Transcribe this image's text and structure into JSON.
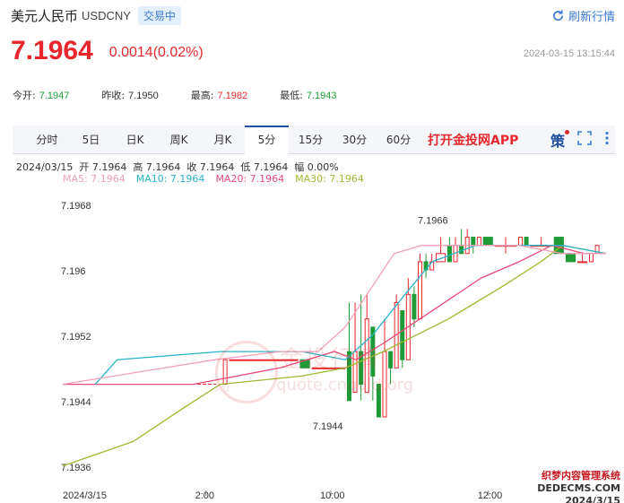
{
  "header": {
    "name": "美元人民币",
    "code": "USDCNY",
    "status": "交易中",
    "refresh_label": "刷新行情"
  },
  "quote": {
    "price": "7.1964",
    "change": "0.0014(0.02%)",
    "timestamp": "2024-03-15 13:15:44"
  },
  "stats": [
    {
      "label": "今开:",
      "value": "7.1947",
      "color": "green"
    },
    {
      "label": "昨收:",
      "value": "7.1950",
      "color": "neutral"
    },
    {
      "label": "最高:",
      "value": "7.1982",
      "color": "red"
    },
    {
      "label": "最低:",
      "value": "7.1943",
      "color": "green"
    }
  ],
  "tabs": [
    "分时",
    "5日",
    "日K",
    "周K",
    "月K",
    "5分",
    "15分",
    "30分",
    "60分"
  ],
  "active_tab": "5分",
  "promo": "打开金投网APP",
  "toolbar": {
    "ce_label": "策"
  },
  "info_line": "2024/03/15  开 7.1964  高 7.1964  收 7.1964  低 7.1964  幅 0.00%",
  "ma_labels": [
    {
      "text": "MA5: 7.1964",
      "color": "#f0a0b8"
    },
    {
      "text": "MA10: 7.1964",
      "color": "#2ab3c9"
    },
    {
      "text": "MA20: 7.1964",
      "color": "#e84a7a"
    },
    {
      "text": "MA30: 7.1964",
      "color": "#9cba2e"
    }
  ],
  "watermark": {
    "title": "金投行情",
    "site": "quote.cngold.org",
    "mark": "Au"
  },
  "corner": {
    "line1": "织梦内容管理系统",
    "line2": "DEDECMS.COM",
    "line3": "2024/3/15"
  },
  "chart_data": {
    "type": "candlestick",
    "y_ticks": [
      "7.1968",
      "7.196",
      "7.1952",
      "7.1944",
      "7.1936"
    ],
    "x_ticks": [
      "2024/3/15",
      "2:00",
      "10:00",
      "12:00"
    ],
    "ylim": [
      7.1934,
      7.197
    ],
    "high_annotation": "7.1966",
    "low_annotation": "7.1944",
    "colors": {
      "up": "#e8262c",
      "down": "#1f9a37",
      "ma5": "#f0a0b8",
      "ma10": "#2ab3c9",
      "ma20": "#e84a7a",
      "ma30": "#9cba2e"
    },
    "candles": [
      {
        "o": 7.1947,
        "c": 7.1947,
        "h": 7.1947,
        "l": 7.1947,
        "n": 26
      },
      {
        "o": 7.1947,
        "c": 7.195,
        "h": 7.195,
        "l": 7.1947,
        "n": 1
      },
      {
        "o": 7.195,
        "c": 7.195,
        "h": 7.195,
        "l": 7.195,
        "n": 12
      },
      {
        "o": 7.195,
        "c": 7.1949,
        "h": 7.195,
        "l": 7.1949,
        "n": 2
      },
      {
        "o": 7.1949,
        "c": 7.1949,
        "h": 7.1949,
        "l": 7.1949,
        "n": 6
      },
      {
        "o": 7.1951,
        "c": 7.1945,
        "h": 7.1957,
        "l": 7.1945,
        "n": 1
      },
      {
        "o": 7.1946,
        "c": 7.1951,
        "h": 7.1957,
        "l": 7.1946,
        "n": 1
      },
      {
        "o": 7.1951,
        "c": 7.1947,
        "h": 7.1958,
        "l": 7.1945,
        "n": 1
      },
      {
        "o": 7.1946,
        "c": 7.1955,
        "h": 7.1958,
        "l": 7.1946,
        "n": 1
      },
      {
        "o": 7.1954,
        "c": 7.1948,
        "h": 7.1954,
        "l": 7.1945,
        "n": 1
      },
      {
        "o": 7.1947,
        "c": 7.1943,
        "h": 7.1947,
        "l": 7.1943,
        "n": 1
      },
      {
        "o": 7.1943,
        "c": 7.1951,
        "h": 7.1955,
        "l": 7.1943,
        "n": 1
      },
      {
        "o": 7.1951,
        "c": 7.1949,
        "h": 7.1951,
        "l": 7.1947,
        "n": 1
      },
      {
        "o": 7.1949,
        "c": 7.1957,
        "h": 7.1958,
        "l": 7.1949,
        "n": 1
      },
      {
        "o": 7.1956,
        "c": 7.195,
        "h": 7.1956,
        "l": 7.1949,
        "n": 1
      },
      {
        "o": 7.195,
        "c": 7.1958,
        "h": 7.196,
        "l": 7.195,
        "n": 1
      },
      {
        "o": 7.1958,
        "c": 7.1955,
        "h": 7.1959,
        "l": 7.1954,
        "n": 1
      },
      {
        "o": 7.1955,
        "c": 7.1962,
        "h": 7.1963,
        "l": 7.1955,
        "n": 1
      },
      {
        "o": 7.1962,
        "c": 7.1961,
        "h": 7.1963,
        "l": 7.196,
        "n": 1
      },
      {
        "o": 7.1961,
        "c": 7.1962,
        "h": 7.1963,
        "l": 7.1961,
        "n": 1
      },
      {
        "o": 7.1962,
        "c": 7.1963,
        "h": 7.1965,
        "l": 7.1962,
        "n": 2
      },
      {
        "o": 7.1964,
        "c": 7.1962,
        "h": 7.1965,
        "l": 7.1962,
        "n": 1
      },
      {
        "o": 7.1962,
        "c": 7.1964,
        "h": 7.1965,
        "l": 7.1962,
        "n": 1
      },
      {
        "o": 7.1964,
        "c": 7.1963,
        "h": 7.1966,
        "l": 7.1963,
        "n": 1
      },
      {
        "o": 7.1963,
        "c": 7.1965,
        "h": 7.1966,
        "l": 7.1963,
        "n": 1
      },
      {
        "o": 7.1965,
        "c": 7.1964,
        "h": 7.1965,
        "l": 7.1963,
        "n": 1
      },
      {
        "o": 7.1964,
        "c": 7.1965,
        "h": 7.1965,
        "l": 7.1964,
        "n": 1
      },
      {
        "o": 7.1965,
        "c": 7.1964,
        "h": 7.1965,
        "l": 7.1964,
        "n": 2
      },
      {
        "o": 7.1964,
        "c": 7.1964,
        "h": 7.1965,
        "l": 7.1963,
        "n": 4
      },
      {
        "o": 7.1964,
        "c": 7.1965,
        "h": 7.1965,
        "l": 7.1964,
        "n": 1
      },
      {
        "o": 7.1965,
        "c": 7.1964,
        "h": 7.1965,
        "l": 7.1964,
        "n": 1
      },
      {
        "o": 7.1964,
        "c": 7.1964,
        "h": 7.1965,
        "l": 7.1964,
        "n": 4
      },
      {
        "o": 7.1965,
        "c": 7.1963,
        "h": 7.1965,
        "l": 7.1963,
        "n": 2
      },
      {
        "o": 7.1963,
        "c": 7.1962,
        "h": 7.1963,
        "l": 7.1962,
        "n": 2
      },
      {
        "o": 7.1962,
        "c": 7.1962,
        "h": 7.1963,
        "l": 7.1962,
        "n": 2
      },
      {
        "o": 7.1962,
        "c": 7.1963,
        "h": 7.1963,
        "l": 7.1962,
        "n": 1
      },
      {
        "o": 7.1963,
        "c": 7.1964,
        "h": 7.1964,
        "l": 7.1963,
        "n": 1
      }
    ],
    "ma": {
      "ma5": [
        [
          7.1947,
          0
        ],
        [
          7.195,
          0.28
        ],
        [
          7.1951,
          0.4
        ],
        [
          7.1951,
          0.47
        ],
        [
          7.1954,
          0.52
        ],
        [
          7.1958,
          0.56
        ],
        [
          7.1963,
          0.61
        ],
        [
          7.1964,
          0.66
        ],
        [
          7.1964,
          0.75
        ],
        [
          7.1964,
          0.84
        ],
        [
          7.1963,
          0.92
        ],
        [
          7.1963,
          1.0
        ]
      ],
      "ma10": [
        [
          7.1947,
          0.06
        ],
        [
          7.195,
          0.1
        ],
        [
          7.1951,
          0.29
        ],
        [
          7.1951,
          0.44
        ],
        [
          7.195,
          0.52
        ],
        [
          7.1953,
          0.57
        ],
        [
          7.1958,
          0.63
        ],
        [
          7.1962,
          0.68
        ],
        [
          7.1964,
          0.76
        ],
        [
          7.1964,
          0.85
        ],
        [
          7.1964,
          0.92
        ],
        [
          7.1963,
          1.0
        ]
      ],
      "ma20": [
        [
          7.1947,
          0
        ],
        [
          7.1947,
          0.24
        ],
        [
          7.1949,
          0.4
        ],
        [
          7.1951,
          0.5
        ],
        [
          7.195,
          0.54
        ],
        [
          7.1952,
          0.59
        ],
        [
          7.1956,
          0.68
        ],
        [
          7.196,
          0.77
        ],
        [
          7.1962,
          0.84
        ],
        [
          7.1964,
          0.9
        ],
        [
          7.1963,
          0.96
        ],
        [
          7.1963,
          1.0
        ]
      ],
      "ma30": [
        [
          7.1937,
          0
        ],
        [
          7.194,
          0.13
        ],
        [
          7.1944,
          0.22
        ],
        [
          7.1947,
          0.29
        ],
        [
          7.1948,
          0.44
        ],
        [
          7.1949,
          0.52
        ],
        [
          7.1951,
          0.59
        ],
        [
          7.1955,
          0.71
        ],
        [
          7.1959,
          0.81
        ],
        [
          7.1962,
          0.88
        ],
        [
          7.1964,
          0.92
        ],
        [
          7.1963,
          1.0
        ]
      ]
    }
  }
}
